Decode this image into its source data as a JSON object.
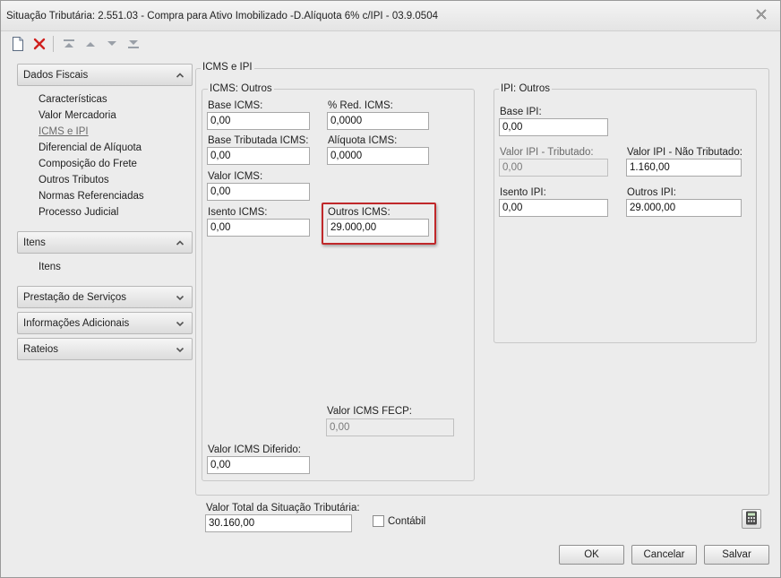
{
  "window": {
    "title": "Situação Tributária: 2.551.03 - Compra para Ativo Imobilizado -D.Alíquota 6% c/IPI - 03.9.0504"
  },
  "toolbar": {
    "icons": [
      "new-document-icon",
      "delete-icon",
      "first-icon",
      "previous-icon",
      "next-icon",
      "last-icon"
    ]
  },
  "sidebar": {
    "dados_fiscais": {
      "label": "Dados Fiscais",
      "expanded": true,
      "items": [
        "Características",
        "Valor Mercadoria",
        "ICMS e IPI",
        "Diferencial de Alíquota",
        "Composição do Frete",
        "Outros Tributos",
        "Normas Referenciadas",
        "Processo Judicial"
      ],
      "active": "ICMS e IPI"
    },
    "itens": {
      "label": "Itens",
      "expanded": true,
      "items": [
        "Itens"
      ]
    },
    "prestacao": {
      "label": "Prestação de Serviços",
      "expanded": false
    },
    "informacoes": {
      "label": "Informações Adicionais",
      "expanded": false
    },
    "rateios": {
      "label": "Rateios",
      "expanded": false
    }
  },
  "main": {
    "group_title": "ICMS e IPI",
    "icms": {
      "title": "ICMS: Outros",
      "base_icms": {
        "label": "Base ICMS:",
        "value": "0,00"
      },
      "red_icms": {
        "label": "% Red. ICMS:",
        "value": "0,0000"
      },
      "base_tributada": {
        "label": "Base Tributada ICMS:",
        "value": "0,00"
      },
      "aliquota_icms": {
        "label": "Alíquota ICMS:",
        "value": "0,0000"
      },
      "valor_icms": {
        "label": "Valor ICMS:",
        "value": "0,00"
      },
      "isento_icms": {
        "label": "Isento ICMS:",
        "value": "0,00"
      },
      "outros_icms": {
        "label": "Outros ICMS:",
        "value": "29.000,00"
      },
      "valor_fecp": {
        "label": "Valor ICMS FECP:",
        "value": "0,00"
      },
      "valor_diferido": {
        "label": "Valor ICMS Diferido:",
        "value": "0,00"
      }
    },
    "ipi": {
      "title": "IPI: Outros",
      "base_ipi": {
        "label": "Base IPI:",
        "value": "0,00"
      },
      "valor_ipi_tributado": {
        "label": "Valor IPI - Tributado:",
        "value": "0,00"
      },
      "valor_ipi_nao_tributado": {
        "label": "Valor IPI - Não Tributado:",
        "value": "1.160,00"
      },
      "isento_ipi": {
        "label": "Isento IPI:",
        "value": "0,00"
      },
      "outros_ipi": {
        "label": "Outros IPI:",
        "value": "29.000,00"
      }
    }
  },
  "footer": {
    "valor_total": {
      "label": "Valor Total da Situação Tributária:",
      "value": "30.160,00"
    },
    "contabil": {
      "label": "Contábil",
      "checked": false
    },
    "ok": "OK",
    "cancelar": "Cancelar",
    "salvar": "Salvar"
  },
  "colors": {
    "highlight": "#c0282a",
    "delete_icon": "#d0201e"
  }
}
